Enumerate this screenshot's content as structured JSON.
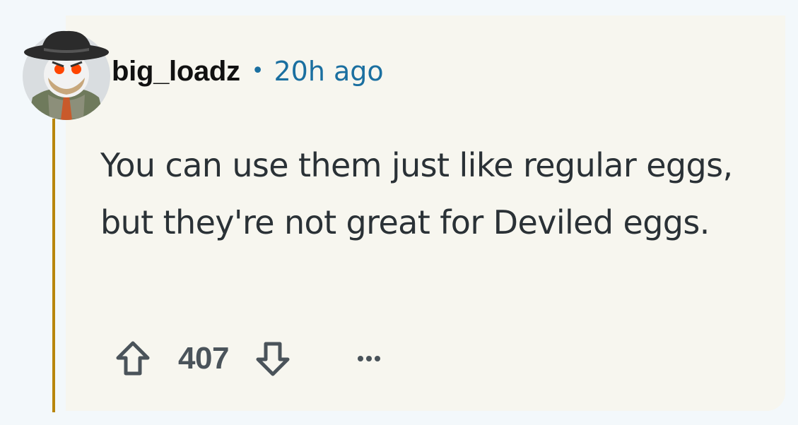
{
  "comment": {
    "author": "big_loadz",
    "separator": "•",
    "timestamp": "20h ago",
    "body": "You can use them just like regular eggs, but they're not great for Deviled eggs.",
    "score": "407"
  },
  "icons": {
    "avatar": "snoo-cowboy-avatar",
    "upvote": "arrow-up-icon",
    "downvote": "arrow-down-icon",
    "more": "ellipsis-icon"
  },
  "colors": {
    "card_background": "#f7f6ef",
    "thread_line": "#b8860b",
    "timestamp": "#1a6fa0",
    "text": "#2a3136",
    "icon": "#4a535a"
  }
}
